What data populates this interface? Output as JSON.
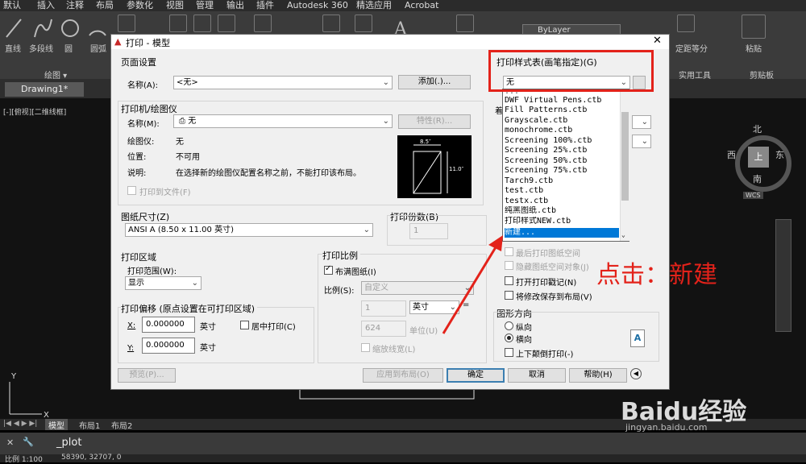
{
  "ribbon": {
    "tabs": [
      "默认",
      "插入",
      "注释",
      "布局",
      "参数化",
      "视图",
      "管理",
      "输出",
      "插件",
      "Autodesk 360",
      "精选应用",
      "Acrobat"
    ],
    "tools": [
      "直线",
      "多段线",
      "圆",
      "圆弧"
    ],
    "draw_label": "绘图 ▾",
    "bylayer": "ByLayer",
    "utility_label": "实用工具",
    "clipboard_label": "剪贴板",
    "paste_label": "粘贴",
    "measure_label": "定距等分"
  },
  "doc": {
    "tab": "Drawing1*",
    "viewport_label": "[-][俯视][二维线框]"
  },
  "viewcube": {
    "north": "北",
    "south": "南",
    "east": "东",
    "west": "西",
    "top": "上",
    "wcs": "WCS"
  },
  "dialog": {
    "title": "打印 - 模型",
    "page_setup": {
      "title": "页面设置",
      "name_label": "名称(A):",
      "name_value": "<无>",
      "add_btn": "添加(.)..."
    },
    "printer": {
      "title": "打印机/绘图仪",
      "name_label": "名称(M):",
      "name_value": "无",
      "props_btn": "特性(R)...",
      "plotter_label": "绘图仪:",
      "plotter_value": "无",
      "location_label": "位置:",
      "location_value": "不可用",
      "desc_label": "说明:",
      "desc_value": "在选择新的绘图仪配置名称之前，不能打印该布局。",
      "print_to_file": "打印到文件(F)",
      "preview_dim": "8.5″",
      "preview_dim_v": "11.0″"
    },
    "paper": {
      "title": "图纸尺寸(Z)",
      "value": "ANSI A (8.50 x 11.00 英寸)"
    },
    "copies": {
      "title": "打印份数(B)",
      "value": "1"
    },
    "area": {
      "title": "打印区域",
      "range_label": "打印范围(W):",
      "range_value": "显示"
    },
    "offset": {
      "title": "打印偏移 (原点设置在可打印区域)",
      "x_label": "X:",
      "x_value": "0.000000",
      "y_label": "Y:",
      "y_value": "0.000000",
      "unit": "英寸",
      "center": "居中打印(C)"
    },
    "scale": {
      "title": "打印比例",
      "fit": "布满图纸(I)",
      "ratio_label": "比例(S):",
      "ratio_value": "自定义",
      "v1": "1",
      "unit1": "英寸",
      "v2": "624",
      "unit2": "单位(U)",
      "lineweights": "缩放线宽(L)"
    },
    "style": {
      "title": "打印样式表(画笔指定)(G)",
      "value": "无",
      "items": [
        "Fill Patterns.ctb",
        "Grayscale.ctb",
        "monochrome.ctb",
        "Screening 100%.ctb",
        "Screening 25%.ctb",
        "Screening 50%.ctb",
        "Screening 75%.ctb",
        "Tarch9.ctb",
        "test.ctb",
        "testx.ctb",
        "纯黑图纸.ctb",
        "打印样式NEW.ctb",
        "新建..."
      ],
      "partial_top": "DWF Virtual Pens.ctb"
    },
    "options": {
      "last_space": "最后打印图纸空间",
      "hide_objects": "隐藏图纸空间对象(J)",
      "stamp": "打开打印戳记(N)",
      "save_changes": "将修改保存到布局(V)"
    },
    "orientation": {
      "title": "图形方向",
      "portrait": "纵向",
      "landscape": "横向",
      "upside_down": "上下颠倒打印(-)"
    },
    "shaded_label": "着",
    "buttons": {
      "preview": "预览(P)...",
      "apply": "应用到布局(O)",
      "ok": "确定",
      "cancel": "取消",
      "help": "帮助(H)"
    }
  },
  "annotation": "点击：新建",
  "layout_tabs": [
    "模型",
    "布局1",
    "布局2"
  ],
  "command": {
    "prompt": "_plot"
  },
  "status": {
    "scale": "比例 1:100",
    "coords": "58390, 32707, 0"
  },
  "watermark": {
    "brand": "Baidu经验",
    "url": "jingyan.baidu.com"
  },
  "colors": {
    "accent_red": "#e3221a",
    "selection": "#0078d7"
  }
}
